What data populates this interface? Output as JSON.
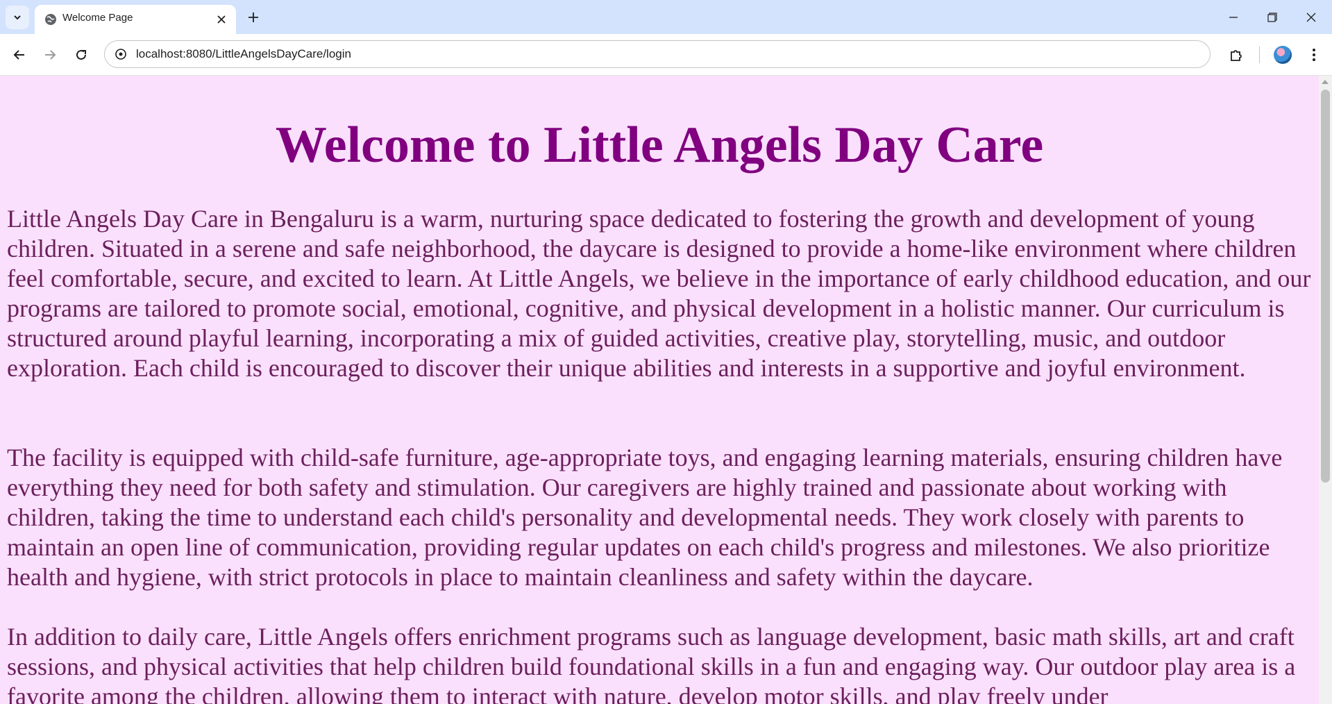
{
  "browser": {
    "tab": {
      "title": "Welcome Page"
    },
    "address_bar": {
      "url": "localhost:8080/LittleAngelsDayCare/login"
    },
    "icons": {
      "tab_search": "chevron-down-icon",
      "favicon": "globe-icon",
      "close": "close-icon",
      "new_tab": "plus-icon",
      "back": "arrow-left-icon",
      "forward": "arrow-right-icon",
      "reload": "reload-icon",
      "site_info": "tune-icon",
      "extensions": "puzzle-icon",
      "profile": "avatar",
      "menu": "kebab-menu-icon",
      "minimize": "minimize-icon",
      "restore": "restore-icon",
      "window_close": "close-icon"
    }
  },
  "page": {
    "title": "Welcome to Little Angels Day Care",
    "paragraphs": [
      "Little Angels Day Care in Bengaluru is a warm, nurturing space dedicated to fostering the growth and development of young children. Situated in a serene and safe neighborhood, the daycare is designed to provide a home-like environment where children feel comfortable, secure, and excited to learn. At Little Angels, we believe in the importance of early childhood education, and our programs are tailored to promote social, emotional, cognitive, and physical development in a holistic manner. Our curriculum is structured around playful learning, incorporating a mix of guided activities, creative play, storytelling, music, and outdoor exploration. Each child is encouraged to discover their unique abilities and interests in a supportive and joyful environment.",
      "The facility is equipped with child-safe furniture, age-appropriate toys, and engaging learning materials, ensuring children have everything they need for both safety and stimulation. Our caregivers are highly trained and passionate about working with children, taking the time to understand each child's personality and developmental needs. They work closely with parents to maintain an open line of communication, providing regular updates on each child's progress and milestones. We also prioritize health and hygiene, with strict protocols in place to maintain cleanliness and safety within the daycare.",
      "In addition to daily care, Little Angels offers enrichment programs such as language development, basic math skills, art and craft sessions, and physical activities that help children build foundational skills in a fun and engaging way. Our outdoor play area is a favorite among the children, allowing them to interact with nature, develop motor skills, and play freely under"
    ],
    "colors": {
      "background": "#fae0fc",
      "title": "#800080",
      "text": "#6b1f5c"
    }
  }
}
